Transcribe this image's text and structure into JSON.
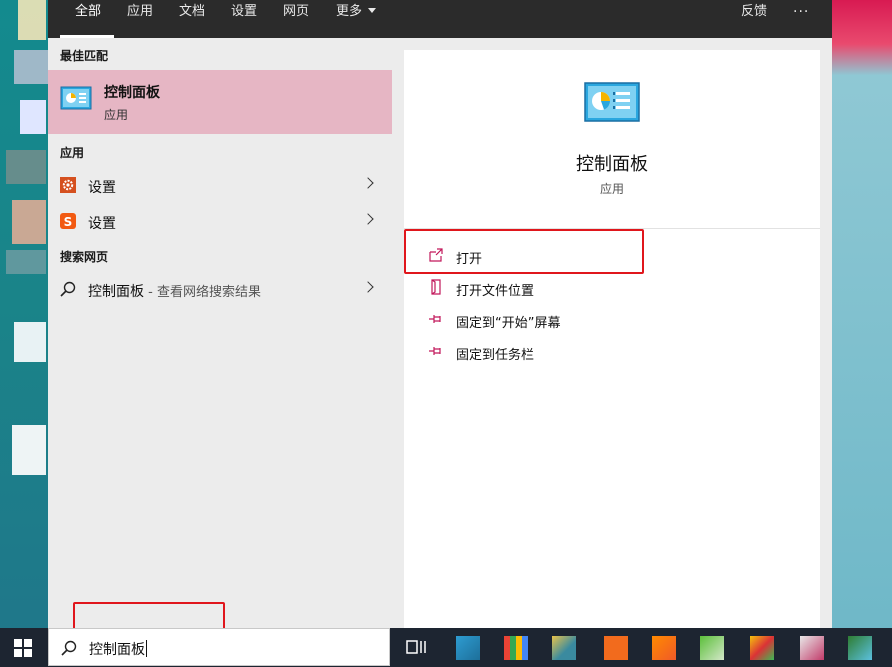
{
  "tabs": [
    {
      "label": "全部",
      "active": true
    },
    {
      "label": "应用"
    },
    {
      "label": "文档"
    },
    {
      "label": "设置"
    },
    {
      "label": "网页"
    },
    {
      "label": "更多"
    }
  ],
  "topbar": {
    "feedback": "反馈",
    "more": "···"
  },
  "sections": {
    "best_match": "最佳匹配",
    "apps": "应用",
    "web": "搜索网页"
  },
  "best_match": {
    "title": "控制面板",
    "subtitle": "应用"
  },
  "apps": [
    {
      "label": "设置",
      "icon": "gear-icon",
      "color": "#d5501f"
    },
    {
      "label": "设置",
      "icon": "sogou-s-icon",
      "color": "#f25a12"
    }
  ],
  "web": {
    "label": "控制面板",
    "suffix": " - 查看网络搜索结果"
  },
  "detail": {
    "title": "控制面板",
    "subtitle": "应用",
    "actions": [
      {
        "label": "打开",
        "icon": "open-icon"
      },
      {
        "label": "打开文件位置",
        "icon": "file-location-icon"
      },
      {
        "label": "固定到“开始”屏幕",
        "icon": "pin-icon"
      },
      {
        "label": "固定到任务栏",
        "icon": "pin-icon"
      }
    ]
  },
  "search": {
    "value": "控制面板"
  },
  "colors": {
    "accent": "#e6b6c4",
    "highlight_box": "#e0161c",
    "topbar": "#2b2b2b",
    "taskbar": "#1d2531",
    "action_icon": "#c2185b"
  }
}
